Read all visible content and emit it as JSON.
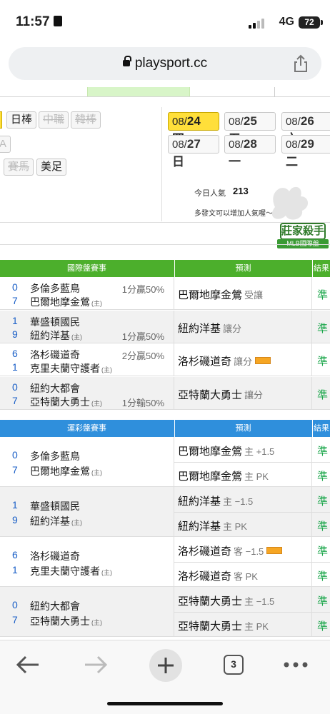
{
  "status": {
    "time": "11:57",
    "network": "4G",
    "battery": "72"
  },
  "browser": {
    "url": "playsport.cc",
    "tab_count": "3"
  },
  "league_tabs": [
    "日棒",
    "中職",
    "韓棒",
    "A",
    "賽馬",
    "美足"
  ],
  "dates": [
    {
      "date": "08/",
      "day": "24",
      "wd": "四",
      "active": true
    },
    {
      "date": "08/",
      "day": "25",
      "wd": "五"
    },
    {
      "date": "08/",
      "day": "26",
      "wd": "六"
    },
    {
      "date": "08/",
      "day": "27",
      "wd": "日"
    },
    {
      "date": "08/",
      "day": "28",
      "wd": "一"
    },
    {
      "date": "08/",
      "day": "29",
      "wd": "二"
    }
  ],
  "popularity": {
    "label": "今日人氣",
    "value": "213",
    "sub": "多發文可以增加人氣喔～"
  },
  "badge": {
    "title": "莊家殺手",
    "sub": "MLB國際盤"
  },
  "table1": {
    "headers": {
      "games": "國際盤賽事",
      "predict": "預測",
      "result": "結果"
    },
    "rows": [
      {
        "s1": "0",
        "t1": "多倫多藍鳥",
        "h1": "1分贏50%",
        "s2": "7",
        "t2": "巴爾地摩金鶯",
        "home": "(主)",
        "h2": "",
        "pred": "巴爾地摩金鶯",
        "ptype": "受讓",
        "res": "準"
      },
      {
        "s1": "1",
        "t1": "華盛頓國民",
        "h1": "",
        "s2": "9",
        "t2": "紐約洋基",
        "home": "(主)",
        "h2": "1分贏50%",
        "pred": "紐約洋基",
        "ptype": "讓分",
        "res": "準"
      },
      {
        "s1": "6",
        "t1": "洛杉磯道奇",
        "h1": "2分贏50%",
        "s2": "1",
        "t2": "克里夫蘭守護者",
        "home": "(主)",
        "h2": "",
        "pred": "洛杉磯道奇",
        "ptype": "讓分",
        "res": "準",
        "ribbon": true
      },
      {
        "s1": "0",
        "t1": "紐約大都會",
        "h1": "",
        "s2": "7",
        "t2": "亞特蘭大勇士",
        "home": "(主)",
        "h2": "1分輸50%",
        "pred": "亞特蘭大勇士",
        "ptype": "讓分",
        "res": "準"
      }
    ]
  },
  "table2": {
    "headers": {
      "games": "運彩盤賽事",
      "predict": "預測",
      "result": "結果"
    },
    "rows": [
      {
        "s1": "0",
        "t1": "多倫多藍鳥",
        "s2": "7",
        "t2": "巴爾地摩金鶯",
        "home": "(主)",
        "preds": [
          {
            "team": "巴爾地摩金鶯",
            "type": "主 +1.5",
            "res": "準"
          },
          {
            "team": "巴爾地摩金鶯",
            "type": "主 PK",
            "res": "準"
          }
        ]
      },
      {
        "s1": "1",
        "t1": "華盛頓國民",
        "s2": "9",
        "t2": "紐約洋基",
        "home": "(主)",
        "preds": [
          {
            "team": "紐約洋基",
            "type": "主 −1.5",
            "res": "準"
          },
          {
            "team": "紐約洋基",
            "type": "主 PK",
            "res": "準"
          }
        ]
      },
      {
        "s1": "6",
        "t1": "洛杉磯道奇",
        "s2": "1",
        "t2": "克里夫蘭守護者",
        "home": "(主)",
        "preds": [
          {
            "team": "洛杉磯道奇",
            "type": "客 −1.5",
            "res": "準",
            "ribbon": true
          },
          {
            "team": "洛杉磯道奇",
            "type": "客 PK",
            "res": "準"
          }
        ]
      },
      {
        "s1": "0",
        "t1": "紐約大都會",
        "s2": "7",
        "t2": "亞特蘭大勇士",
        "home": "(主)",
        "preds": [
          {
            "team": "亞特蘭大勇士",
            "type": "主 −1.5",
            "res": "準"
          },
          {
            "team": "亞特蘭大勇士",
            "type": "主 PK",
            "res": "準"
          }
        ]
      }
    ]
  },
  "colors": {
    "green_header": "#4caf2c",
    "blue_header": "#2f8fdc",
    "active_date": "#ffdf3a",
    "result": "#1aa64a"
  },
  "icons": [
    "back-icon",
    "forward-icon",
    "new-tab-icon",
    "tabs-icon",
    "more-icon",
    "share-icon",
    "lock-icon"
  ]
}
